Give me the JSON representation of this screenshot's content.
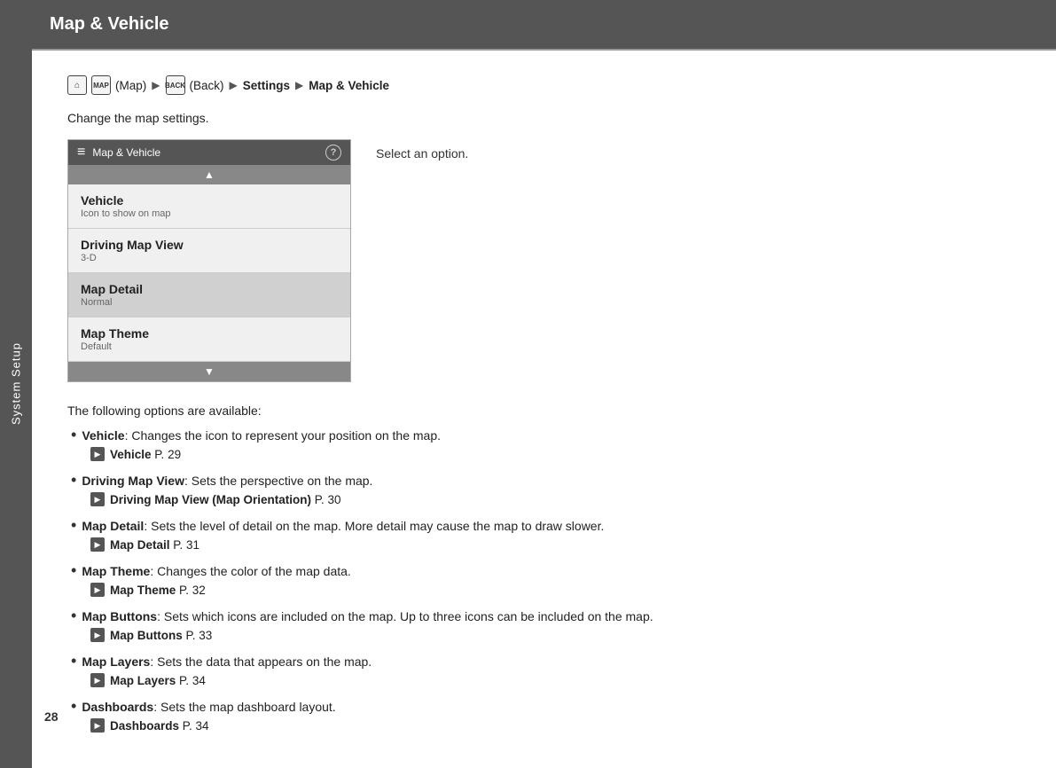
{
  "sidebar": {
    "label": "System Setup"
  },
  "header": {
    "title": "Map & Vehicle"
  },
  "breadcrumb": {
    "home_icon": "⌂",
    "map_icon": "MAP",
    "map_label": "(Map)",
    "back_icon": "BACK",
    "back_label": "(Back)",
    "arrow": "▶",
    "settings": "Settings",
    "current": "Map & Vehicle"
  },
  "description": "Change the map settings.",
  "screenshot": {
    "header_title": "Map & Vehicle",
    "help": "?",
    "menu_icon": "≡",
    "items": [
      {
        "title": "Vehicle",
        "sub": "Icon to show on map",
        "highlighted": false
      },
      {
        "title": "Driving Map View",
        "sub": "3-D",
        "highlighted": false
      },
      {
        "title": "Map Detail",
        "sub": "Normal",
        "highlighted": true
      },
      {
        "title": "Map Theme",
        "sub": "Default",
        "highlighted": false
      }
    ]
  },
  "select_label": "Select an option.",
  "options_intro": "The following options are available:",
  "options": [
    {
      "title": "Vehicle",
      "description": ": Changes the icon to represent your position on the map.",
      "ref_bold": "Vehicle",
      "ref_page": "P. 29"
    },
    {
      "title": "Driving Map View",
      "description": ": Sets the perspective on the map.",
      "ref_bold": "Driving Map View (Map Orientation)",
      "ref_page": "P. 30"
    },
    {
      "title": "Map Detail",
      "description": ": Sets the level of detail on the map. More detail may cause the map to draw slower.",
      "ref_bold": "Map Detail",
      "ref_page": "P. 31"
    },
    {
      "title": "Map Theme",
      "description": ": Changes the color of the map data.",
      "ref_bold": "Map Theme",
      "ref_page": "P. 32"
    },
    {
      "title": "Map Buttons",
      "description": ": Sets which icons are included on the map. Up to three icons can be included on the map.",
      "ref_bold": "Map Buttons",
      "ref_page": "P. 33"
    },
    {
      "title": "Map Layers",
      "description": ": Sets the data that appears on the map.",
      "ref_bold": "Map Layers",
      "ref_page": "P. 34"
    },
    {
      "title": "Dashboards",
      "description": ": Sets the map dashboard layout.",
      "ref_bold": "Dashboards",
      "ref_page": "P. 34"
    }
  ],
  "page_number": "28"
}
